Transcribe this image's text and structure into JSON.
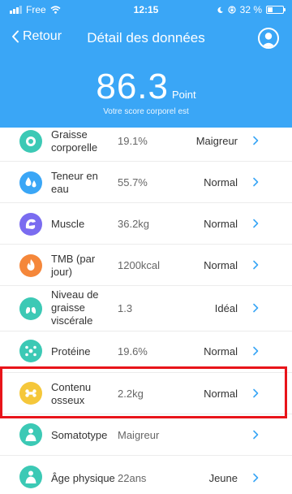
{
  "status_bar": {
    "carrier": "Free",
    "time": "12:15",
    "battery": "32 %",
    "battery_level": 0.32
  },
  "nav": {
    "back_label": "Retour",
    "title": "Détail des données"
  },
  "score": {
    "value": "86.3",
    "unit": "Point",
    "caption": "Votre score corporel est"
  },
  "metrics": [
    {
      "name": "Graisse corporelle",
      "value": "19.1%",
      "status": "Maigreur",
      "icon": "fat-icon",
      "color": "#3cc9b5"
    },
    {
      "name": "Teneur en eau",
      "value": "55.7%",
      "status": "Normal",
      "icon": "water-drops-icon",
      "color": "#3aa6f6"
    },
    {
      "name": "Muscle",
      "value": "36.2kg",
      "status": "Normal",
      "icon": "muscle-icon",
      "color": "#7a6cf0"
    },
    {
      "name": "TMB (par jour)",
      "value": "1200kcal",
      "status": "Normal",
      "icon": "flame-icon",
      "color": "#f5873a"
    },
    {
      "name": "Niveau de graisse viscérale",
      "value": "1.3",
      "status": "Idéal",
      "icon": "lungs-icon",
      "color": "#3cc9b5"
    },
    {
      "name": "Protéine",
      "value": "19.6%",
      "status": "Normal",
      "icon": "molecule-icon",
      "color": "#3cc9b5"
    },
    {
      "name": "Contenu osseux",
      "value": "2.2kg",
      "status": "Normal",
      "icon": "bone-icon",
      "color": "#f5c73a"
    },
    {
      "name": "Somatotype",
      "value": "Maigreur",
      "status": "",
      "icon": "body-type-icon",
      "color": "#3cc9b5"
    },
    {
      "name": "Âge physique",
      "value": "22ans",
      "status": "Jeune",
      "icon": "body-age-icon",
      "color": "#3cc9b5"
    }
  ],
  "highlight": {
    "row": "Contenu osseux",
    "color": "#e8141a"
  }
}
